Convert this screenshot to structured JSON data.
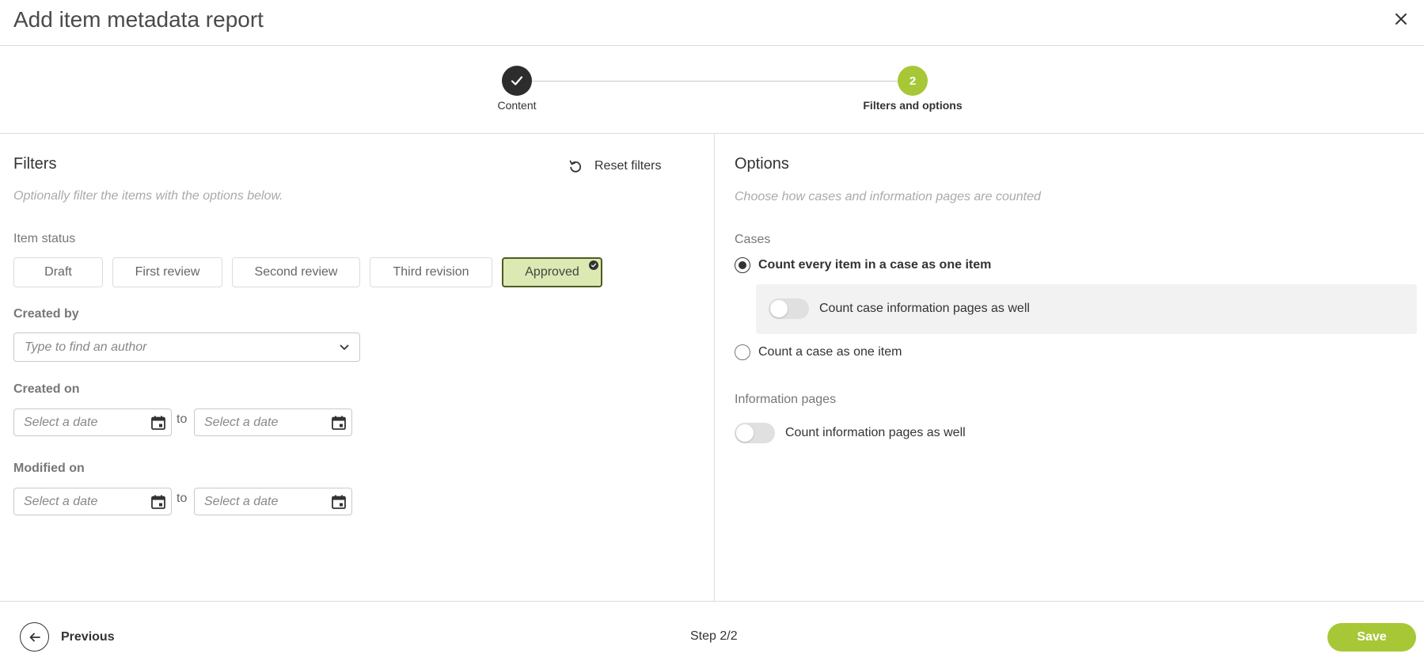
{
  "dialog": {
    "title": "Add item metadata report"
  },
  "stepper": {
    "steps": [
      {
        "label": "Content",
        "state": "completed"
      },
      {
        "label": "Filters and options",
        "number": "2",
        "state": "active"
      }
    ]
  },
  "filters": {
    "title": "Filters",
    "reset_label": "Reset filters",
    "hint": "Optionally filter the items with the options below.",
    "item_status": {
      "label": "Item status",
      "options": [
        "Draft",
        "First review",
        "Second review",
        "Third revision",
        "Approved"
      ],
      "selected": "Approved"
    },
    "created_by": {
      "label": "Created by",
      "placeholder": "Type to find an author"
    },
    "created_on": {
      "label": "Created on",
      "from_placeholder": "Select a date",
      "to_text": "to",
      "to_placeholder": "Select a date"
    },
    "modified_on": {
      "label": "Modified on",
      "from_placeholder": "Select a date",
      "to_text": "to",
      "to_placeholder": "Select a date"
    }
  },
  "options": {
    "title": "Options",
    "hint": "Choose how cases and information pages are counted",
    "cases": {
      "label": "Cases",
      "radio_every_item": "Count every item in a case as one item",
      "toggle_case_info_pages": "Count case information pages as well",
      "radio_case_one_item": "Count a case as one item",
      "selected": "Count every item in a case as one item"
    },
    "information_pages": {
      "label": "Information pages",
      "toggle_info_pages": "Count information pages as well"
    }
  },
  "footer": {
    "previous_label": "Previous",
    "step_count": "Step 2/2",
    "save_label": "Save"
  },
  "colors": {
    "accent": "#a7c737",
    "dark": "#2d2d2d",
    "selected_chip_bg": "#dce9b3"
  }
}
